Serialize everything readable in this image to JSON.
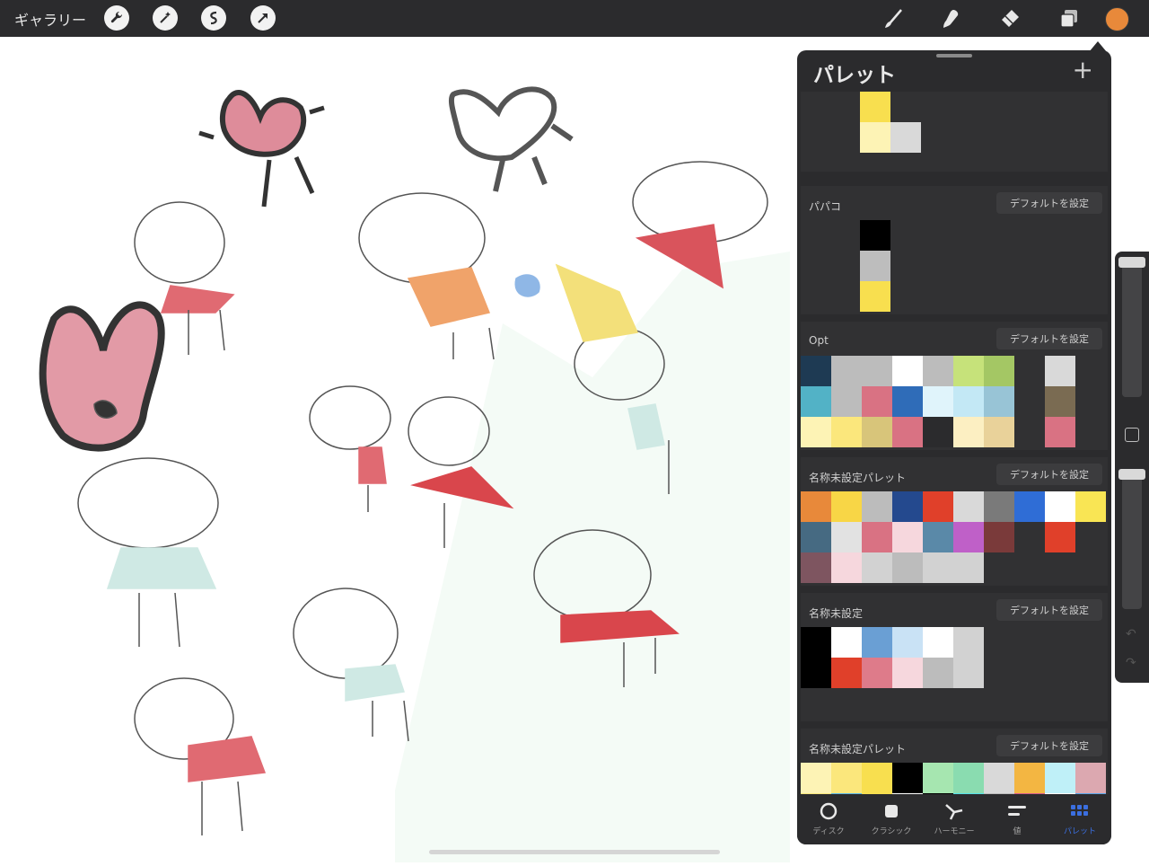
{
  "topbar": {
    "gallery_label": "ギャラリー",
    "left_tools": [
      "wrench-icon",
      "magic-wand-icon",
      "selection-icon",
      "transform-arrow-icon"
    ],
    "right_tools": [
      "brush-icon",
      "smudge-icon",
      "eraser-icon",
      "layers-icon"
    ],
    "current_color": "#e8893a"
  },
  "palette_panel": {
    "title": "パレット",
    "add_label": "+",
    "default_button_label": "デフォルトを設定",
    "cards": [
      {
        "name": "",
        "show_default": false,
        "rows": [
          [
            null,
            "#f8df4f",
            null
          ],
          [
            null,
            "#fdf3b5",
            "#d9d9d9"
          ]
        ]
      },
      {
        "name": "パパコ",
        "show_default": true,
        "rows": [
          [
            null,
            "#000000"
          ],
          [
            null,
            "#bdbdbd"
          ],
          [
            null,
            "#f8df4f"
          ]
        ]
      },
      {
        "name": "Opt",
        "show_default": true,
        "rows": [
          [
            "#1e3a53",
            "#bcbcbc",
            "#bcbcbc",
            "#ffffff",
            "#bcbcbc",
            "#c6e27a",
            "#a4c764",
            null,
            "#d9d9d9"
          ],
          [
            "#52b2c6",
            "#bcbcbc",
            "#d97283",
            "#2f6cb8",
            "#e0f4fb",
            "#c3e8f5",
            "#98c4d6",
            null,
            "#7a6b52"
          ],
          [
            "#fdf3b5",
            "#fbe77c",
            "#d8c57a",
            "#d97283",
            "#2b2b2d",
            "#fcefc2",
            "#e9d29a",
            null,
            "#d97283"
          ]
        ]
      },
      {
        "name": "名称未設定パレット",
        "show_default": true,
        "rows": [
          [
            "#e8893a",
            "#f8d646",
            "#bcbcbc",
            "#24498e",
            "#e0402a",
            "#d9d9d9",
            "#7a7a7a",
            "#2f6dd6",
            "#ffffff",
            "#f9e554"
          ],
          [
            "#466a82",
            "#e2e2e2",
            "#d97283",
            "#f6d7dd",
            "#5a89a8",
            "#bf60c8",
            "#7a3a3a",
            null,
            "#e0402a",
            null
          ],
          [
            "#7e5560",
            "#f6d7dd",
            "#d2d2d2",
            "#bcbcbc",
            "#d2d2d2",
            "#d2d2d2",
            null,
            null,
            null,
            null
          ]
        ]
      },
      {
        "name": "名称未設定",
        "show_default": true,
        "rows": [
          [
            "#000000",
            "#ffffff",
            "#6a9fd4",
            "#c9e2f5",
            "#ffffff",
            "#d2d2d2"
          ],
          [
            "#000000",
            "#e0402a",
            "#de7b8a",
            "#f6d7dd",
            "#bcbcbc",
            "#d2d2d2"
          ]
        ]
      },
      {
        "name": "名称未設定パレット",
        "show_default": true,
        "rows": [
          [
            "#fdf3b5",
            "#fbe77c",
            "#f8df4f",
            "#000000",
            "#a6e6b0",
            "#8adcb0",
            "#d9d9d9",
            "#f3b642",
            "#bff0f8",
            "#dca8b0"
          ],
          [
            "#fbe77c",
            "#56b4e9",
            "#f8df4f",
            "#ffffff",
            "#000000",
            "#56e0e9",
            "#bcbcbc",
            "#d65a8a",
            "#ffffff",
            "#56a4e9"
          ]
        ]
      }
    ],
    "tabs": [
      {
        "label": "ディスク",
        "icon": "disc-icon",
        "active": false
      },
      {
        "label": "クラシック",
        "icon": "classic-square-icon",
        "active": false
      },
      {
        "label": "ハーモニー",
        "icon": "harmony-icon",
        "active": false
      },
      {
        "label": "値",
        "icon": "value-sliders-icon",
        "active": false
      },
      {
        "label": "パレット",
        "icon": "palette-grid-icon",
        "active": true
      }
    ]
  }
}
